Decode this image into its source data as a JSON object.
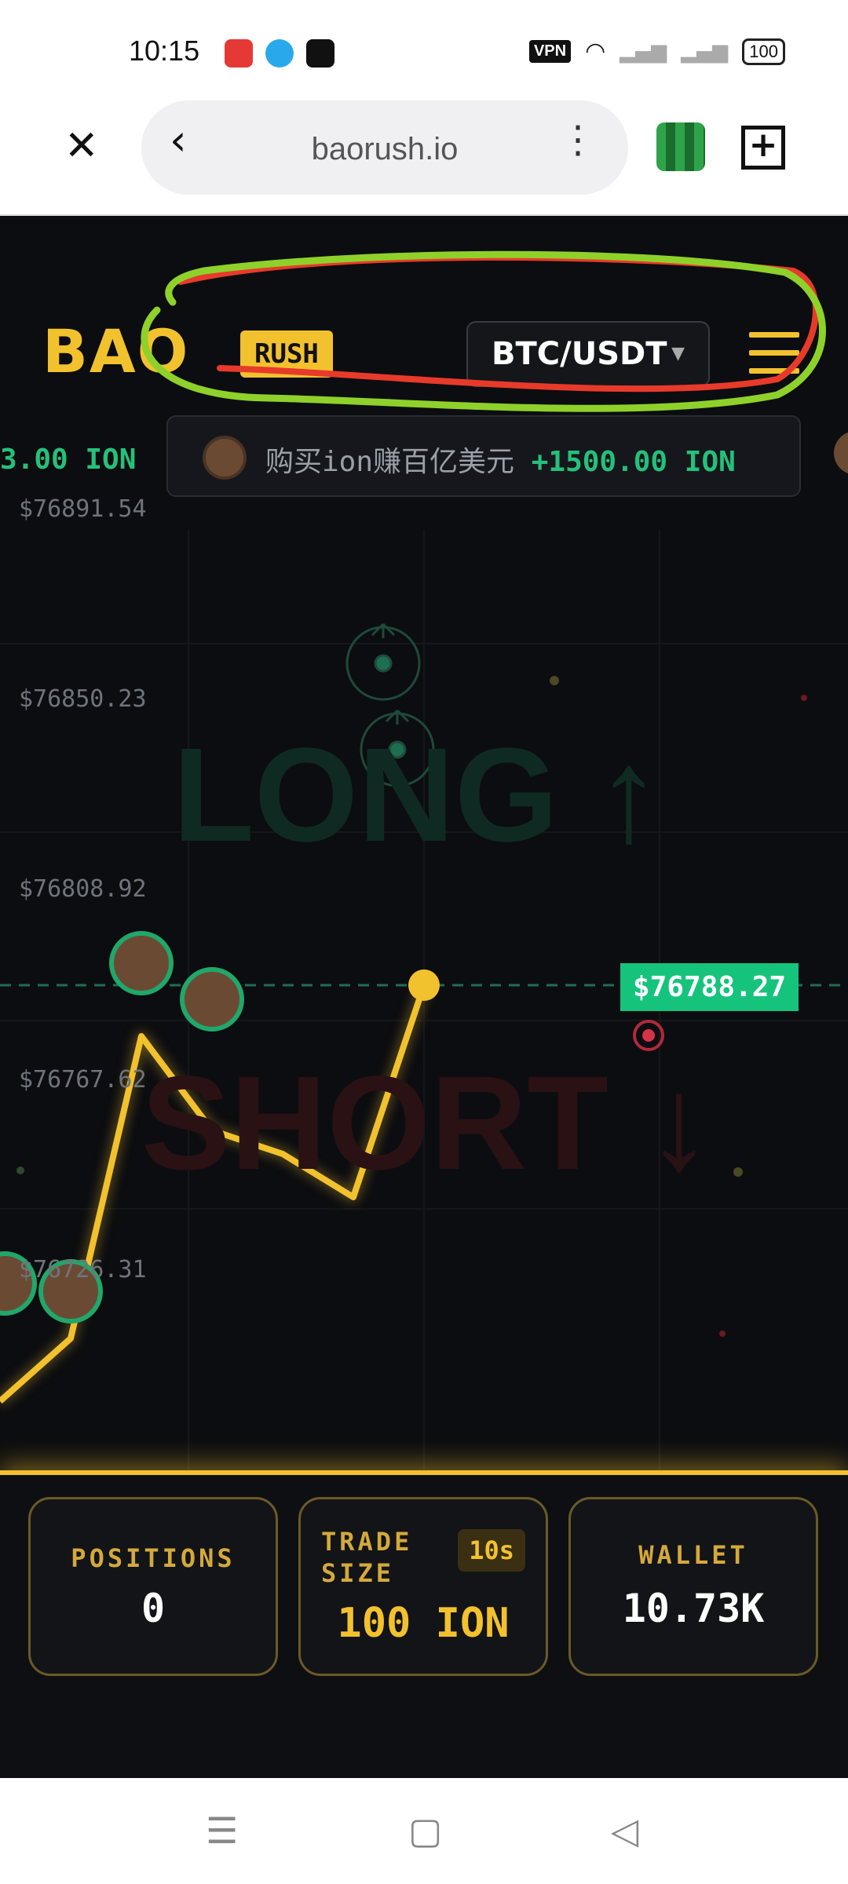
{
  "status_bar": {
    "time": "10:15",
    "vpn": "VPN",
    "battery": "100"
  },
  "browser": {
    "url": "baorush.io"
  },
  "app": {
    "logo": "BAO",
    "badge": "RUSH",
    "pair": "BTC/USDT",
    "ticker": {
      "left_fragment": "3.00 ION",
      "message": "购买ion赚百亿美元",
      "amount": "+1500.00 ION"
    },
    "price_labels": [
      "$76891.54",
      "$76850.23",
      "$76808.92",
      "$76767.62",
      "$76726.31"
    ],
    "long_label": "LONG ↑",
    "short_label": "SHORT ↓",
    "current_price": "$76788.27"
  },
  "chart_data": {
    "type": "line",
    "y_ticks": [
      76891.54,
      76850.23,
      76808.92,
      76767.62,
      76726.31
    ],
    "series": [
      {
        "values": [
          76700,
          76720,
          76782,
          76755,
          76740,
          76735,
          76788
        ]
      }
    ],
    "current_price": 76788.27
  },
  "panel": {
    "positions_label": "POSITIONS",
    "positions_value": "0",
    "trade_size_label": "TRADE SIZE",
    "trade_size_badge": "10s",
    "trade_size_value": "100 ION",
    "wallet_label": "WALLET",
    "wallet_value": "10.73K"
  },
  "colors": {
    "accent": "#f2c12e",
    "long": "#25c07a",
    "short": "#d6334a",
    "background": "#0c0d10"
  }
}
